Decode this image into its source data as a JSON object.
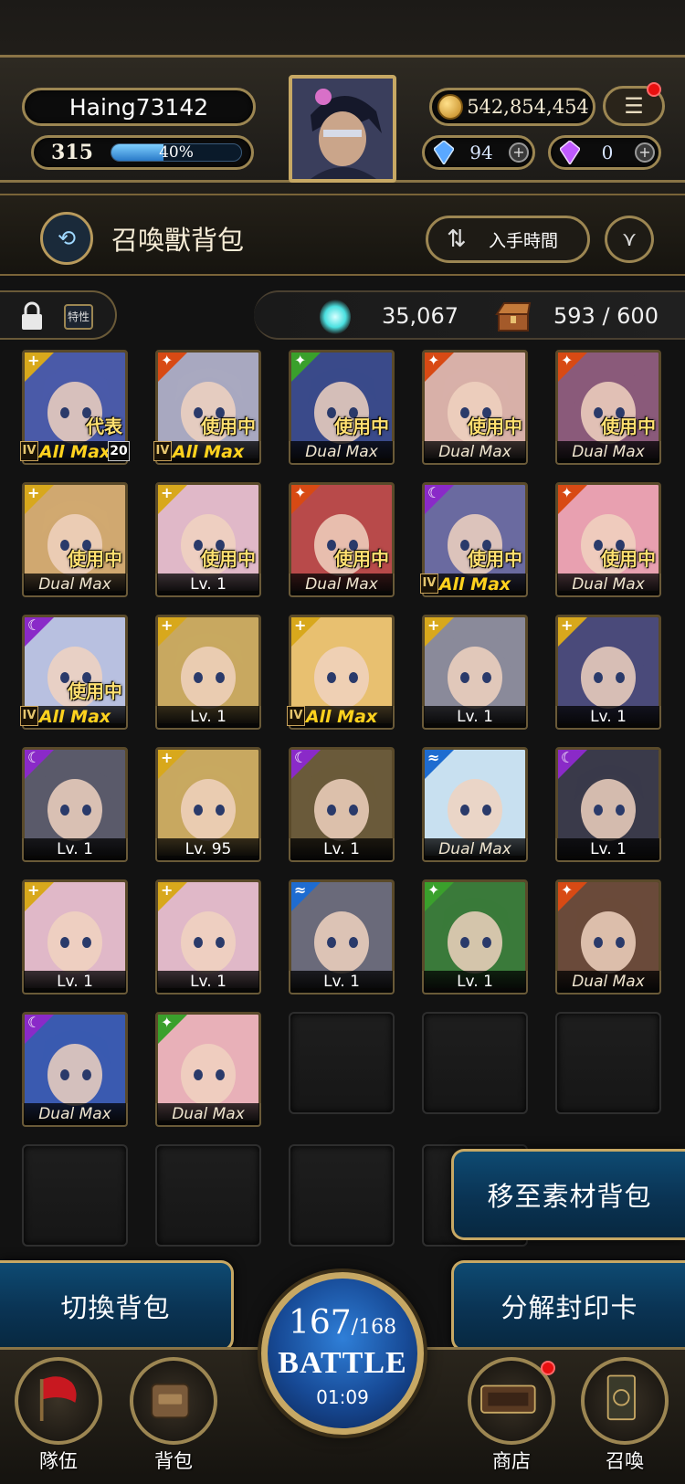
{
  "player": {
    "name": "Haing73142",
    "level": "315",
    "exp_percent": "40%",
    "exp_fraction": 0.4
  },
  "currency": {
    "gold": "542,854,454",
    "gems_blue": "94",
    "gems_purple": "0"
  },
  "page": {
    "title": "召喚獸背包",
    "sort_label": "入手時間"
  },
  "info": {
    "trait_label": "特性",
    "orb_count": "35,067",
    "capacity": "593 / 600"
  },
  "cards": [
    {
      "element": "light",
      "status": "代表",
      "footer": "All Max",
      "footer_style": "allmax",
      "rank": "IV",
      "plus": "20"
    },
    {
      "element": "fire",
      "status": "使用中",
      "footer": "All Max",
      "footer_style": "allmax",
      "rank": "IV",
      "plus": ""
    },
    {
      "element": "wind",
      "status": "使用中",
      "footer": "Dual Max",
      "footer_style": "dualmax",
      "rank": "",
      "plus": ""
    },
    {
      "element": "fire",
      "status": "使用中",
      "footer": "Dual Max",
      "footer_style": "dualmax",
      "rank": "",
      "plus": ""
    },
    {
      "element": "fire",
      "status": "使用中",
      "footer": "Dual Max",
      "footer_style": "dualmax",
      "rank": "",
      "plus": ""
    },
    {
      "element": "light",
      "status": "使用中",
      "footer": "Dual Max",
      "footer_style": "dualmax",
      "rank": "",
      "plus": ""
    },
    {
      "element": "light",
      "status": "使用中",
      "footer": "Lv. 1",
      "footer_style": "lv",
      "rank": "",
      "plus": ""
    },
    {
      "element": "fire",
      "status": "使用中",
      "footer": "Dual Max",
      "footer_style": "dualmax",
      "rank": "",
      "plus": ""
    },
    {
      "element": "dark",
      "status": "使用中",
      "footer": "All Max",
      "footer_style": "allmax",
      "rank": "IV",
      "plus": ""
    },
    {
      "element": "fire",
      "status": "使用中",
      "footer": "Dual Max",
      "footer_style": "dualmax",
      "rank": "",
      "plus": ""
    },
    {
      "element": "dark",
      "status": "使用中",
      "footer": "All Max",
      "footer_style": "allmax",
      "rank": "IV",
      "plus": ""
    },
    {
      "element": "light",
      "status": "",
      "footer": "Lv. 1",
      "footer_style": "lv",
      "rank": "",
      "plus": ""
    },
    {
      "element": "light",
      "status": "",
      "footer": "All Max",
      "footer_style": "allmax",
      "rank": "IV",
      "plus": ""
    },
    {
      "element": "light",
      "status": "",
      "footer": "Lv. 1",
      "footer_style": "lv",
      "rank": "",
      "plus": ""
    },
    {
      "element": "light",
      "status": "",
      "footer": "Lv. 1",
      "footer_style": "lv",
      "rank": "",
      "plus": ""
    },
    {
      "element": "dark",
      "status": "",
      "footer": "Lv. 1",
      "footer_style": "lv",
      "rank": "",
      "plus": ""
    },
    {
      "element": "light",
      "status": "",
      "footer": "Lv. 95",
      "footer_style": "lv",
      "rank": "",
      "plus": ""
    },
    {
      "element": "dark",
      "status": "",
      "footer": "Lv. 1",
      "footer_style": "lv",
      "rank": "",
      "plus": ""
    },
    {
      "element": "water",
      "status": "",
      "footer": "Dual Max",
      "footer_style": "dualmax",
      "rank": "",
      "plus": ""
    },
    {
      "element": "dark",
      "status": "",
      "footer": "Lv. 1",
      "footer_style": "lv",
      "rank": "",
      "plus": ""
    },
    {
      "element": "light",
      "status": "",
      "footer": "Lv. 1",
      "footer_style": "lv",
      "rank": "",
      "plus": ""
    },
    {
      "element": "light",
      "status": "",
      "footer": "Lv. 1",
      "footer_style": "lv",
      "rank": "",
      "plus": ""
    },
    {
      "element": "water",
      "status": "",
      "footer": "Lv. 1",
      "footer_style": "lv",
      "rank": "",
      "plus": ""
    },
    {
      "element": "wind",
      "status": "",
      "footer": "Lv. 1",
      "footer_style": "lv",
      "rank": "",
      "plus": ""
    },
    {
      "element": "fire",
      "status": "",
      "footer": "Dual Max",
      "footer_style": "dualmax",
      "rank": "",
      "plus": ""
    },
    {
      "element": "dark",
      "status": "",
      "footer": "Dual Max",
      "footer_style": "dualmax",
      "rank": "",
      "plus": ""
    },
    {
      "element": "wind",
      "status": "",
      "footer": "Dual Max",
      "footer_style": "dualmax",
      "rank": "",
      "plus": ""
    }
  ],
  "element_colors": {
    "light": "#d8a81c",
    "fire": "#d84a14",
    "wind": "#3aa02c",
    "water": "#1e6cd0",
    "dark": "#8a2ac8"
  },
  "portrait_colors": [
    "#4a5aa8",
    "#a8a8c0",
    "#3a4a8a",
    "#d8b0a8",
    "#8a5a7a",
    "#d0a870",
    "#e0b8c8",
    "#b84a4a",
    "#6a6aa0",
    "#e8a0b0",
    "#b8c0e0",
    "#c8a860",
    "#e8c070",
    "#8a8a9a",
    "#4a4a7a",
    "#5a5a6a",
    "#c8a860",
    "#6a5a3a",
    "#c8e0f0",
    "#3a3a4a",
    "#e0b8c8",
    "#e0b8c8",
    "#6a6a7a",
    "#3a7a3a",
    "#6a4a3a",
    "#3a5ab0",
    "#e8b0b8"
  ],
  "actions": {
    "move_to_material": "移至素材背包",
    "switch_bag": "切換背包",
    "decompose": "分解封印卡"
  },
  "battle": {
    "stamina_current": "167",
    "stamina_max": "/168",
    "label": "BATTLE",
    "timer": "01:09"
  },
  "nav": {
    "team": "隊伍",
    "bag": "背包",
    "shop": "商店",
    "summon": "召喚"
  }
}
